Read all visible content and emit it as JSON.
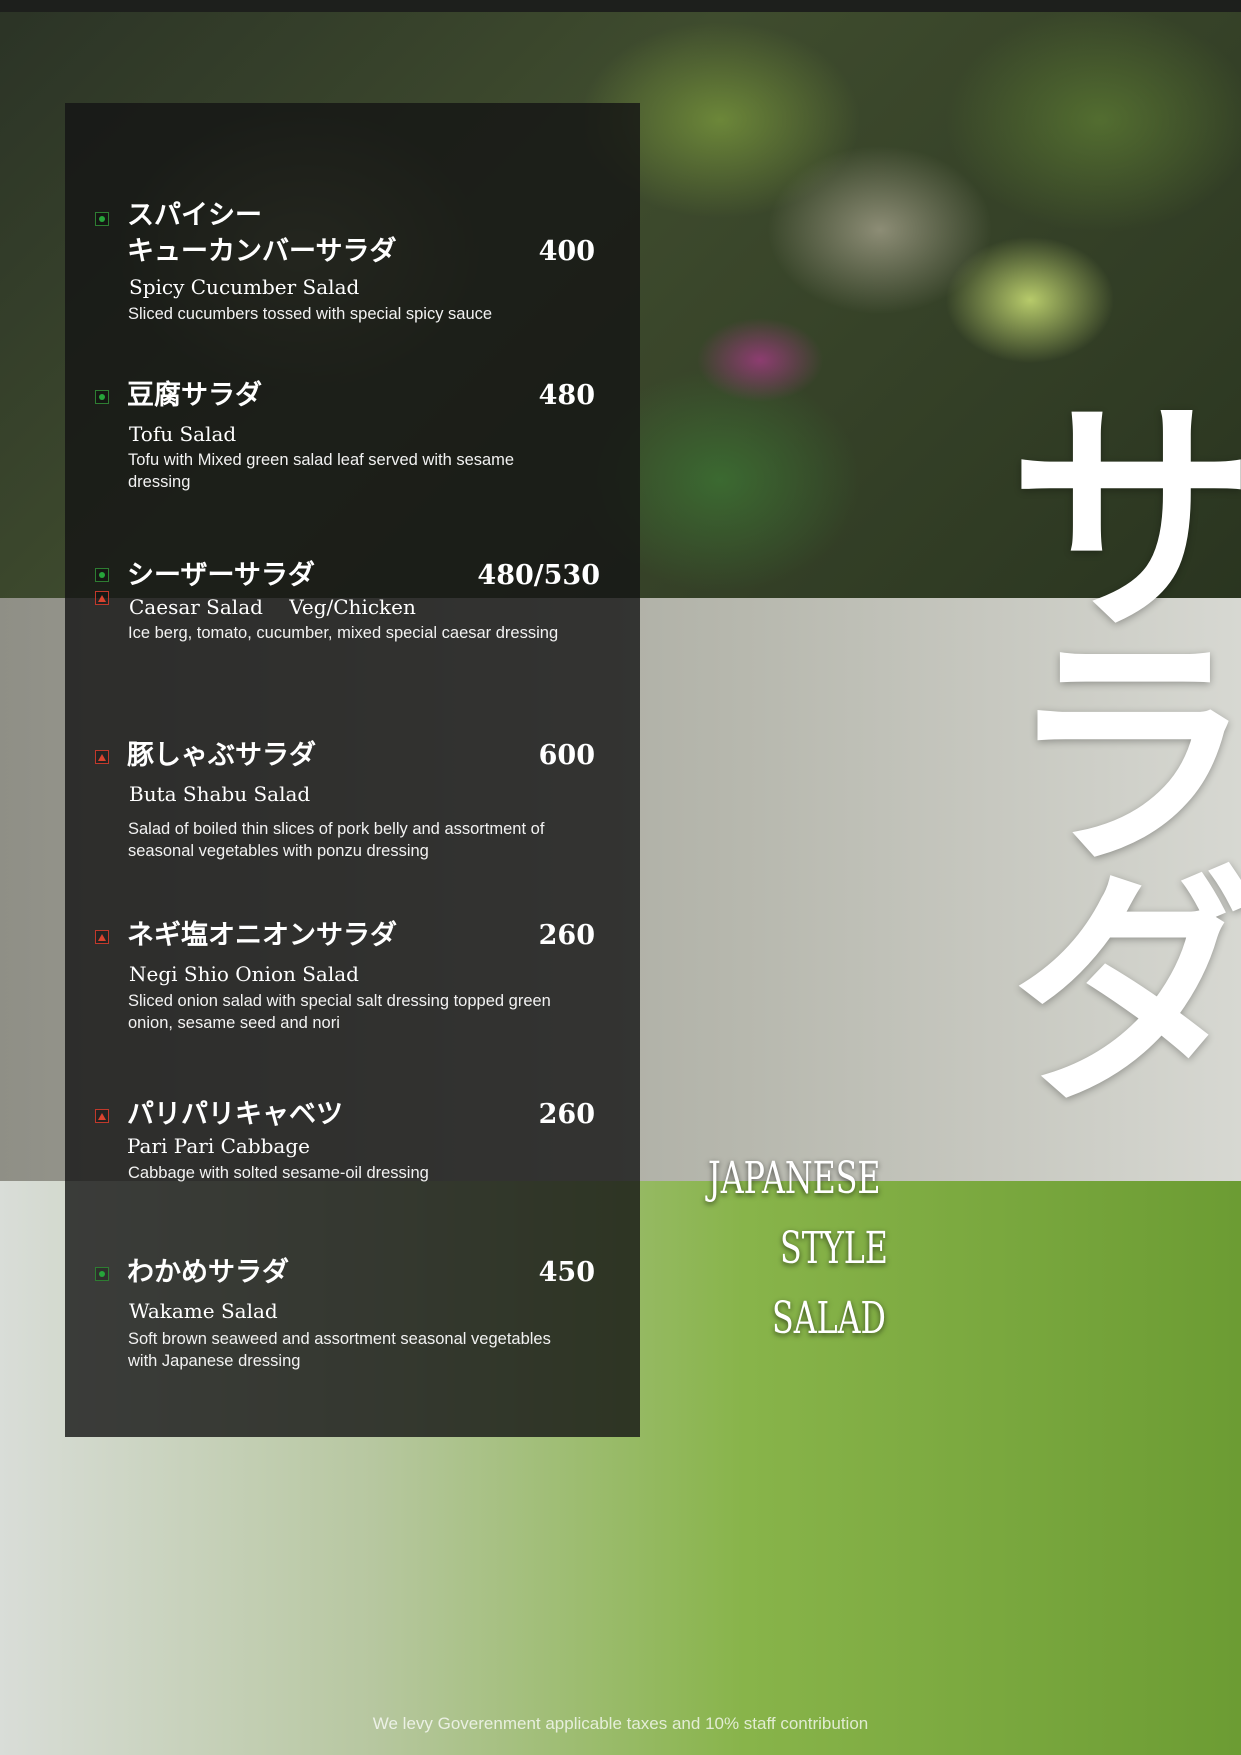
{
  "menu": {
    "items": [
      {
        "jp": "スパイシー",
        "jp2": "キューカンバーサラダ",
        "price": "400",
        "en": "Spicy Cucumber Salad",
        "desc": "Sliced cucumbers tossed with special spicy sauce"
      },
      {
        "jp": "豆腐サラダ",
        "price": "480",
        "en": "Tofu Salad",
        "desc": "Tofu with Mixed green salad leaf served with sesame dressing"
      },
      {
        "jp": "シーザーサラダ",
        "price": "480/530",
        "en": "Caesar Salad　 Veg/Chicken",
        "desc": "Ice berg, tomato, cucumber, mixed special caesar dressing"
      },
      {
        "jp": "豚しゃぶサラダ",
        "price": "600",
        "en": "Buta Shabu Salad",
        "desc": "Salad of boiled thin slices of pork belly and assortment of seasonal vegetables with ponzu dressing"
      },
      {
        "jp": "ネギ塩オニオンサラダ",
        "price": "260",
        "en": "Negi Shio Onion Salad",
        "desc": "Sliced onion salad with special salt dressing topped green onion, sesame seed and nori"
      },
      {
        "jp": "パリパリキャベツ",
        "price": "260",
        "en": "Pari Pari Cabbage",
        "desc": "Cabbage with solted sesame-oil dressing"
      },
      {
        "jp": "わかめサラダ",
        "price": "450",
        "en": "Wakame Salad",
        "desc": "Soft brown seaweed and assortment seasonal vegetables with Japanese dressing"
      }
    ]
  },
  "title": {
    "jp": "サラダ",
    "line1": "JAPANESE",
    "line2": "STYLE",
    "line3": "SALAD"
  },
  "footer": "We levy Goverenment applicable taxes and 10% staff contribution",
  "colors": {
    "veg_marker": "#26a43a",
    "nonveg_marker": "#d9442f",
    "panel": "rgba(20,20,20,0.80)"
  }
}
